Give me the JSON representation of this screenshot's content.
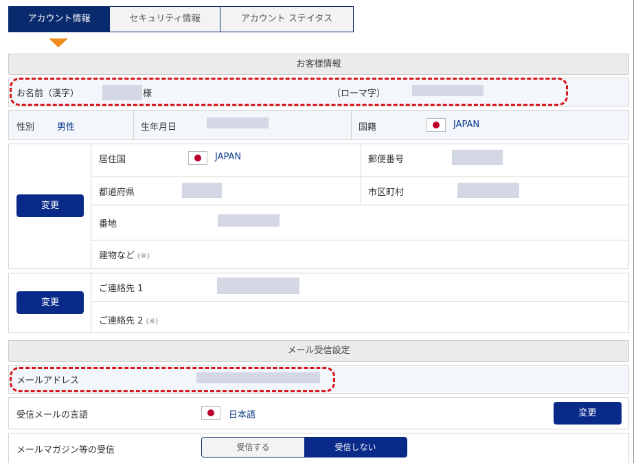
{
  "tabs": [
    {
      "label": "アカウント情報",
      "active": true
    },
    {
      "label": "セキュリティ情報",
      "active": false
    },
    {
      "label": "アカウント ステイタス",
      "active": false
    }
  ],
  "customer": {
    "section_title": "お客様情報",
    "name_kanji_label": "お名前（漢字）",
    "name_suffix": "様",
    "name_roman_label": "（ローマ字）",
    "gender_label": "性別",
    "gender_value": "男性",
    "birthdate_label": "生年月日",
    "nationality_label": "国籍",
    "nationality_value": "JAPAN",
    "residence_label": "居住国",
    "residence_value": "JAPAN",
    "postal_label": "郵便番号",
    "prefecture_label": "都道府県",
    "city_label": "市区町村",
    "street_label": "番地",
    "building_label": "建物など",
    "building_note": "(※)",
    "contact1_label": "ご連絡先 1",
    "contact2_label": "ご連絡先 2",
    "contact2_note": "(※)",
    "change_label": "変更"
  },
  "mail": {
    "section_title": "メール受信設定",
    "email_label": "メールアドレス",
    "language_label": "受信メールの言語",
    "language_value": "日本語",
    "change_label": "変更",
    "magazine_label": "メールマガジン等の受信",
    "receive_label": "受信する",
    "no_receive_label": "受信しない",
    "selected": "受信しない"
  },
  "colors": {
    "accent": "#0a2a8a",
    "highlight": "#d8141a",
    "arrow": "#f08b1d"
  }
}
